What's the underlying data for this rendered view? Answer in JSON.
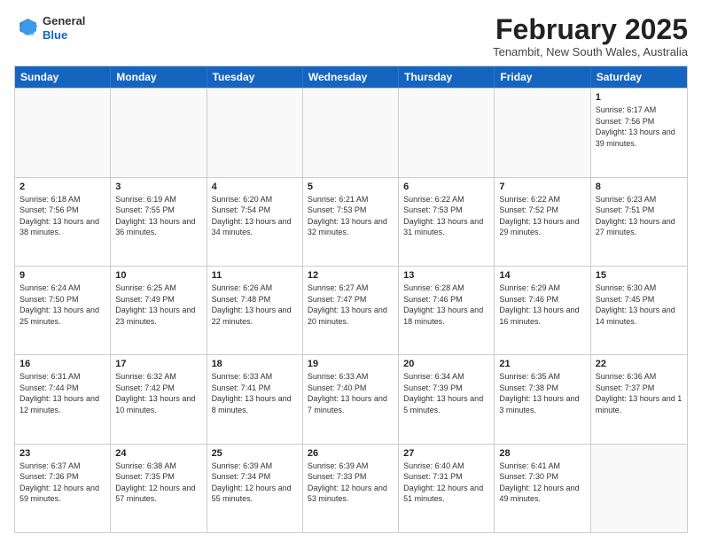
{
  "logo": {
    "general": "General",
    "blue": "Blue"
  },
  "header": {
    "month_title": "February 2025",
    "location": "Tenambit, New South Wales, Australia"
  },
  "days_of_week": [
    "Sunday",
    "Monday",
    "Tuesday",
    "Wednesday",
    "Thursday",
    "Friday",
    "Saturday"
  ],
  "weeks": [
    [
      {
        "day": "",
        "info": ""
      },
      {
        "day": "",
        "info": ""
      },
      {
        "day": "",
        "info": ""
      },
      {
        "day": "",
        "info": ""
      },
      {
        "day": "",
        "info": ""
      },
      {
        "day": "",
        "info": ""
      },
      {
        "day": "1",
        "info": "Sunrise: 6:17 AM\nSunset: 7:56 PM\nDaylight: 13 hours and 39 minutes."
      }
    ],
    [
      {
        "day": "2",
        "info": "Sunrise: 6:18 AM\nSunset: 7:56 PM\nDaylight: 13 hours and 38 minutes."
      },
      {
        "day": "3",
        "info": "Sunrise: 6:19 AM\nSunset: 7:55 PM\nDaylight: 13 hours and 36 minutes."
      },
      {
        "day": "4",
        "info": "Sunrise: 6:20 AM\nSunset: 7:54 PM\nDaylight: 13 hours and 34 minutes."
      },
      {
        "day": "5",
        "info": "Sunrise: 6:21 AM\nSunset: 7:53 PM\nDaylight: 13 hours and 32 minutes."
      },
      {
        "day": "6",
        "info": "Sunrise: 6:22 AM\nSunset: 7:53 PM\nDaylight: 13 hours and 31 minutes."
      },
      {
        "day": "7",
        "info": "Sunrise: 6:22 AM\nSunset: 7:52 PM\nDaylight: 13 hours and 29 minutes."
      },
      {
        "day": "8",
        "info": "Sunrise: 6:23 AM\nSunset: 7:51 PM\nDaylight: 13 hours and 27 minutes."
      }
    ],
    [
      {
        "day": "9",
        "info": "Sunrise: 6:24 AM\nSunset: 7:50 PM\nDaylight: 13 hours and 25 minutes."
      },
      {
        "day": "10",
        "info": "Sunrise: 6:25 AM\nSunset: 7:49 PM\nDaylight: 13 hours and 23 minutes."
      },
      {
        "day": "11",
        "info": "Sunrise: 6:26 AM\nSunset: 7:48 PM\nDaylight: 13 hours and 22 minutes."
      },
      {
        "day": "12",
        "info": "Sunrise: 6:27 AM\nSunset: 7:47 PM\nDaylight: 13 hours and 20 minutes."
      },
      {
        "day": "13",
        "info": "Sunrise: 6:28 AM\nSunset: 7:46 PM\nDaylight: 13 hours and 18 minutes."
      },
      {
        "day": "14",
        "info": "Sunrise: 6:29 AM\nSunset: 7:46 PM\nDaylight: 13 hours and 16 minutes."
      },
      {
        "day": "15",
        "info": "Sunrise: 6:30 AM\nSunset: 7:45 PM\nDaylight: 13 hours and 14 minutes."
      }
    ],
    [
      {
        "day": "16",
        "info": "Sunrise: 6:31 AM\nSunset: 7:44 PM\nDaylight: 13 hours and 12 minutes."
      },
      {
        "day": "17",
        "info": "Sunrise: 6:32 AM\nSunset: 7:42 PM\nDaylight: 13 hours and 10 minutes."
      },
      {
        "day": "18",
        "info": "Sunrise: 6:33 AM\nSunset: 7:41 PM\nDaylight: 13 hours and 8 minutes."
      },
      {
        "day": "19",
        "info": "Sunrise: 6:33 AM\nSunset: 7:40 PM\nDaylight: 13 hours and 7 minutes."
      },
      {
        "day": "20",
        "info": "Sunrise: 6:34 AM\nSunset: 7:39 PM\nDaylight: 13 hours and 5 minutes."
      },
      {
        "day": "21",
        "info": "Sunrise: 6:35 AM\nSunset: 7:38 PM\nDaylight: 13 hours and 3 minutes."
      },
      {
        "day": "22",
        "info": "Sunrise: 6:36 AM\nSunset: 7:37 PM\nDaylight: 13 hours and 1 minute."
      }
    ],
    [
      {
        "day": "23",
        "info": "Sunrise: 6:37 AM\nSunset: 7:36 PM\nDaylight: 12 hours and 59 minutes."
      },
      {
        "day": "24",
        "info": "Sunrise: 6:38 AM\nSunset: 7:35 PM\nDaylight: 12 hours and 57 minutes."
      },
      {
        "day": "25",
        "info": "Sunrise: 6:39 AM\nSunset: 7:34 PM\nDaylight: 12 hours and 55 minutes."
      },
      {
        "day": "26",
        "info": "Sunrise: 6:39 AM\nSunset: 7:33 PM\nDaylight: 12 hours and 53 minutes."
      },
      {
        "day": "27",
        "info": "Sunrise: 6:40 AM\nSunset: 7:31 PM\nDaylight: 12 hours and 51 minutes."
      },
      {
        "day": "28",
        "info": "Sunrise: 6:41 AM\nSunset: 7:30 PM\nDaylight: 12 hours and 49 minutes."
      },
      {
        "day": "",
        "info": ""
      }
    ]
  ]
}
